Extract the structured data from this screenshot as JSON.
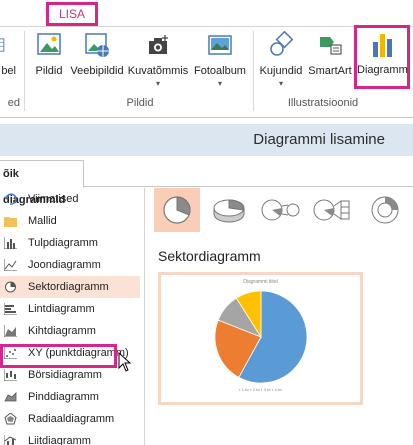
{
  "ribbon": {
    "tab_active": "LISA",
    "left_cut_label": "bel",
    "left_cut_group": "ed",
    "buttons": [
      {
        "id": "pildid",
        "label": "Pildid"
      },
      {
        "id": "veebipildid",
        "label": "Veebipildid"
      },
      {
        "id": "kuvatommis",
        "label": "Kuvatõmmis"
      },
      {
        "id": "fotoalbum",
        "label": "Fotoalbum"
      },
      {
        "id": "kujundid",
        "label": "Kujundid"
      },
      {
        "id": "smartart",
        "label": "SmartArt"
      },
      {
        "id": "diagramm",
        "label": "Diagramm"
      }
    ],
    "groups": {
      "pildid": "Pildid",
      "illustratsioonid": "Illustratsioonid"
    },
    "accent_color": "#d6268c"
  },
  "dialog": {
    "title": "Diagrammi lisamine",
    "tab_label": "õik diagrammid",
    "left_items": [
      {
        "label": "Viimatised",
        "icon": "recent-icon"
      },
      {
        "label": "Mallid",
        "icon": "folder-icon"
      },
      {
        "label": "Tulpdiagramm",
        "icon": "column-chart-icon"
      },
      {
        "label": "Joondiagramm",
        "icon": "line-chart-icon"
      },
      {
        "label": "Sektordiagramm",
        "icon": "pie-chart-icon"
      },
      {
        "label": "Lintdiagramm",
        "icon": "bar-chart-icon"
      },
      {
        "label": "Kihtdiagramm",
        "icon": "area-chart-icon"
      },
      {
        "label": "XY (punktdiagramm)",
        "icon": "scatter-chart-icon"
      },
      {
        "label": "Börsidiagramm",
        "icon": "stock-chart-icon"
      },
      {
        "label": "Pinddiagramm",
        "icon": "surface-chart-icon"
      },
      {
        "label": "Radiaaldiagramm",
        "icon": "radar-chart-icon"
      },
      {
        "label": "Liitdiagramm",
        "icon": "combo-chart-icon"
      }
    ],
    "selected_item": "Sektordiagramm",
    "subtypes": [
      "pie",
      "3d-pie",
      "pie-of-pie",
      "bar-of-pie",
      "doughnut"
    ],
    "selected_subtype": "pie",
    "subtype_title": "Sektordiagramm",
    "preview": {
      "title": "Diagrammi tiitel",
      "legend": "▪ 1.kv ▪ 2.kv ▪ 3.kv ▪ 4.kv",
      "colors": [
        "#5b9bd5",
        "#ed7d31",
        "#a5a5a5",
        "#ffc000"
      ],
      "values": [
        58,
        23,
        10,
        9
      ]
    }
  }
}
